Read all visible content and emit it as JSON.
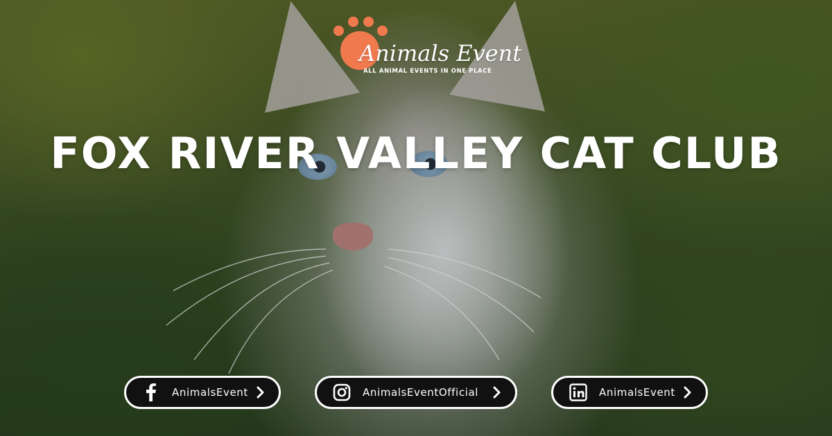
{
  "logo": {
    "name": "Animals Event",
    "tagline": "ALL ANIMAL EVENTS IN ONE PLACE"
  },
  "title": "FOX RIVER VALLEY CAT CLUB",
  "social": [
    {
      "platform": "facebook",
      "icon": "facebook-icon",
      "label": "AnimalsEvent"
    },
    {
      "platform": "instagram",
      "icon": "instagram-icon",
      "label": "AnimalsEventOfficial"
    },
    {
      "platform": "linkedin",
      "icon": "linkedin-icon",
      "label": "AnimalsEvent"
    }
  ],
  "colors": {
    "brand_orange": "#f07a4e",
    "pill_background": "#111111",
    "text": "#ffffff"
  }
}
